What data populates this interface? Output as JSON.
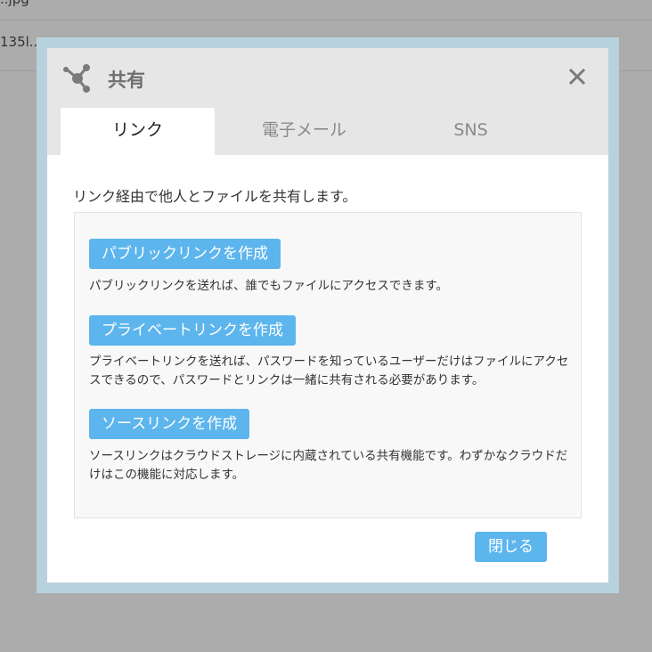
{
  "background": {
    "row1_text": "..jpg",
    "row2_text": "135l.."
  },
  "dialog": {
    "title": "共有",
    "icon": "share-icon",
    "close_icon": "close-icon",
    "tabs": [
      {
        "label": "リンク",
        "active": true
      },
      {
        "label": "電子メール",
        "active": false
      },
      {
        "label": "SNS",
        "active": false
      }
    ],
    "intro": "リンク経由で他人とファイルを共有します。",
    "options": [
      {
        "button": "パブリックリンクを作成",
        "description": "パブリックリンクを送れば、誰でもファイルにアクセスできます。"
      },
      {
        "button": "プライベートリンクを作成",
        "description": "プライベートリンクを送れば、パスワードを知っているユーザーだけはファイルにアクセスできるので、パスワードとリンクは一緒に共有される必要があります。"
      },
      {
        "button": "ソースリンクを作成",
        "description": "ソースリンクはクラウドストレージに内蔵されている共有機能です。わずかなクラウドだけはこの機能に対応します。"
      }
    ],
    "close_button": "閉じる"
  },
  "colors": {
    "overlay": "#acacac",
    "frame": "#b8d2dd",
    "header": "#e6e6e6",
    "accent_button": "#5cb5ed",
    "panel": "#f8f8f8"
  }
}
